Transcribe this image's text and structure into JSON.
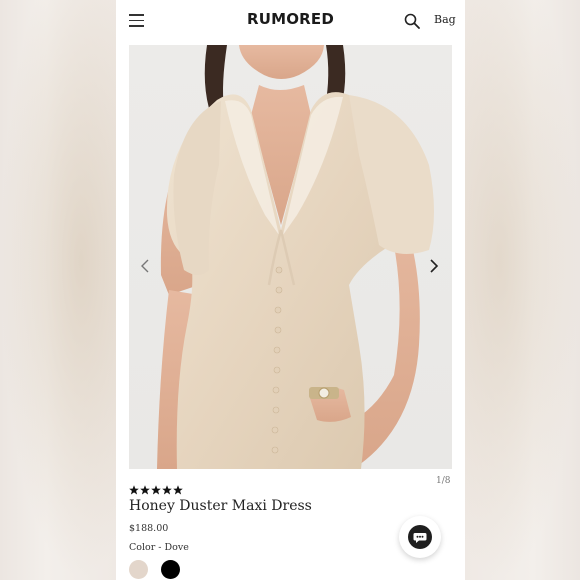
{
  "header": {
    "brand": "RUMORED",
    "bag_label": "Bag",
    "menu_icon": "hamburger-menu-icon",
    "search_icon": "search-icon"
  },
  "gallery": {
    "counter": "1/8",
    "prev_icon": "chevron-left-icon",
    "next_icon": "chevron-right-icon"
  },
  "product": {
    "rating_stars": 5,
    "rating_icon": "star-icon",
    "name": "Honey Duster Maxi Dress",
    "price": "$188.00",
    "color_label": "Color - Dove",
    "swatches": [
      {
        "name": "Dove",
        "color": "#e3d6cb",
        "selected": true
      },
      {
        "name": "Black",
        "color": "#000000",
        "selected": false
      }
    ]
  },
  "chat": {
    "icon": "chat-bubble-icon"
  },
  "colors": {
    "accent": "#1b1b1b",
    "background": "#efe9e4",
    "dress": "#e8d9c4"
  }
}
